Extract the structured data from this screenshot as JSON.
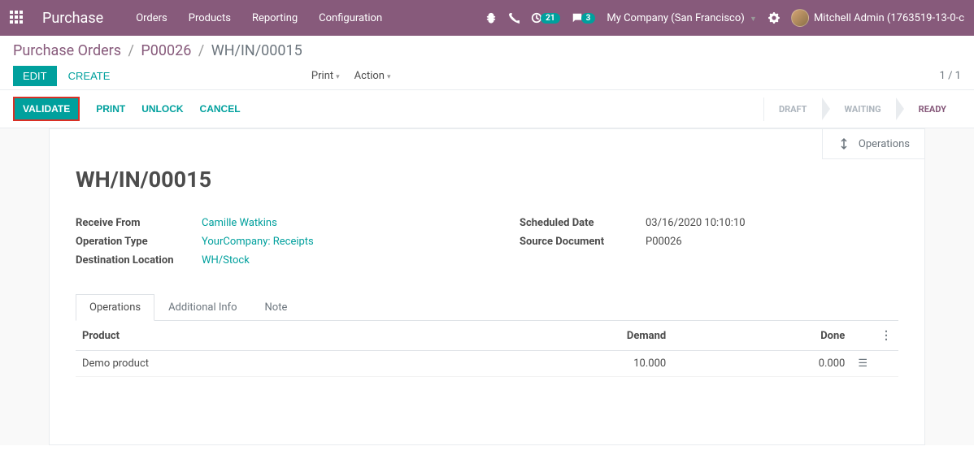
{
  "nav": {
    "app_title": "Purchase",
    "menu": [
      "Orders",
      "Products",
      "Reporting",
      "Configuration"
    ],
    "activity_badge": "21",
    "discuss_badge": "3",
    "company": "My Company (San Francisco)",
    "user": "Mitchell Admin (1763519-13-0-c"
  },
  "breadcrumb": {
    "root": "Purchase Orders",
    "parent": "P00026",
    "current": "WH/IN/00015"
  },
  "controls": {
    "edit": "EDIT",
    "create": "CREATE",
    "print": "Print",
    "action": "Action",
    "pager": "1 / 1"
  },
  "buttons": {
    "validate": "VALIDATE",
    "print": "PRINT",
    "unlock": "UNLOCK",
    "cancel": "CANCEL"
  },
  "status_steps": {
    "draft": "DRAFT",
    "waiting": "WAITING",
    "ready": "READY"
  },
  "stat_button": {
    "label": "Operations"
  },
  "record": {
    "title": "WH/IN/00015",
    "receive_from_label": "Receive From",
    "receive_from": "Camille Watkins",
    "operation_type_label": "Operation Type",
    "operation_type": "YourCompany: Receipts",
    "destination_label": "Destination Location",
    "destination": "WH/Stock",
    "scheduled_label": "Scheduled Date",
    "scheduled": "03/16/2020 10:10:10",
    "source_label": "Source Document",
    "source": "P00026"
  },
  "tabs": {
    "operations": "Operations",
    "additional": "Additional Info",
    "note": "Note"
  },
  "table": {
    "headers": {
      "product": "Product",
      "demand": "Demand",
      "done": "Done"
    },
    "rows": [
      {
        "product": "Demo product",
        "demand": "10.000",
        "done": "0.000"
      }
    ]
  }
}
